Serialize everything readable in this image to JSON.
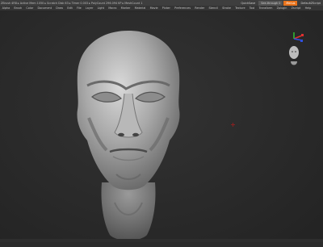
{
  "titlebar": {
    "title": "ZBrush 4R8  ▸ Active Mem 1050  ▸ Scratch Disk 63  ▸ Timer 0.003  ▸ PolyCount 296.094 KP  ▸ MeshCount 1",
    "buttons": [
      "QuickSave",
      "See-through 0",
      "Menus",
      "DefaultZScript"
    ],
    "accent_color": "#e8731c"
  },
  "menubar": {
    "items": [
      "Alpha",
      "Brush",
      "Color",
      "Document",
      "Draw",
      "Edit",
      "File",
      "Layer",
      "Light",
      "Macro",
      "Marker",
      "Material",
      "Movie",
      "Picker",
      "Preferences",
      "Render",
      "Stencil",
      "Stroke",
      "Texture",
      "Tool",
      "Transform",
      "Zplugin",
      "Zscript",
      "Help"
    ]
  },
  "viewport": {
    "model": "sculpted-head",
    "navigation": "head-navigation-cube"
  }
}
